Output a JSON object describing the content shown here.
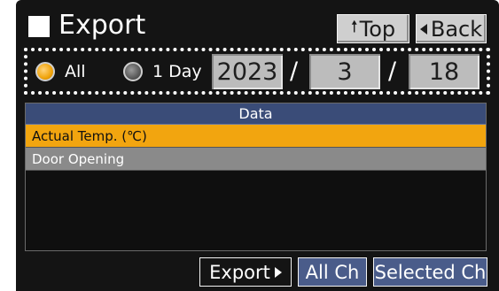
{
  "header": {
    "title": "Export",
    "top_button": "Top",
    "back_button": "Back"
  },
  "date_selector": {
    "all_label": "All",
    "one_day_label": "1 Day",
    "selected": "All",
    "year": "2023",
    "month": "3",
    "day": "18",
    "separator": "/"
  },
  "data_list": {
    "header": "Data",
    "items": [
      {
        "label": "Actual Temp. (℃)",
        "selected": true
      },
      {
        "label": "Door Opening",
        "selected": false
      }
    ]
  },
  "footer": {
    "export_button": "Export",
    "all_ch_button": "All Ch",
    "selected_ch_button": "Selected Ch"
  },
  "colors": {
    "selected_row": "#f2a50f",
    "header_blue": "#3a4c78",
    "button_blue": "#4a5c8a"
  }
}
